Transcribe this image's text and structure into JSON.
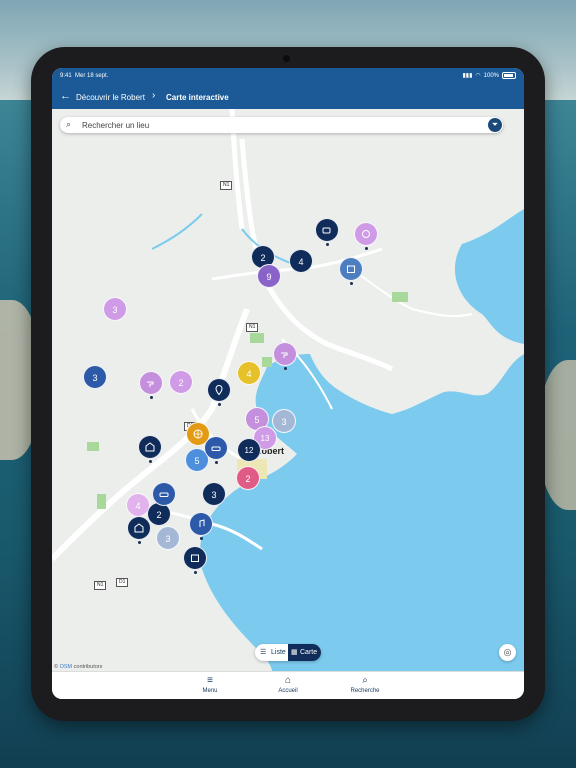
{
  "status_bar": {
    "time": "9:41",
    "date": "Mer 18 sept.",
    "battery": "100%"
  },
  "nav": {
    "breadcrumb_parent": "Découvrir le Robert",
    "breadcrumb_current": "Carte interactive"
  },
  "search": {
    "placeholder": "Rechercher un lieu"
  },
  "map": {
    "place_label": "Robert",
    "road_tags": [
      "N1",
      "N1",
      "D1",
      "N1",
      "D1"
    ],
    "attribution_prefix": "© ",
    "attribution_osm": "OSM",
    "attribution_suffix": " contributors",
    "clusters": [
      {
        "label": "3"
      },
      {
        "label": "2"
      },
      {
        "label": "4"
      },
      {
        "label": "9"
      },
      {
        "label": "3"
      },
      {
        "label": "2"
      },
      {
        "label": "4"
      },
      {
        "label": "5"
      },
      {
        "label": "3"
      },
      {
        "label": "13"
      },
      {
        "label": "12"
      },
      {
        "label": "5"
      },
      {
        "label": "2"
      },
      {
        "label": "3"
      },
      {
        "label": "4"
      },
      {
        "label": "2"
      },
      {
        "label": "3"
      }
    ]
  },
  "view_toggle": {
    "list_label": "Liste",
    "map_label": "Carte"
  },
  "tabs": {
    "menu": "Menu",
    "home": "Accueil",
    "search": "Recherche"
  },
  "colors": {
    "header": "#1b5a96",
    "sea": "#7ccbef",
    "navy_pin": "#0f2c5a",
    "purple_pin": "#cf9be6",
    "pink_pin": "#e05b85",
    "yellow_pin": "#e6c12a",
    "orange_pin": "#e39a14"
  }
}
